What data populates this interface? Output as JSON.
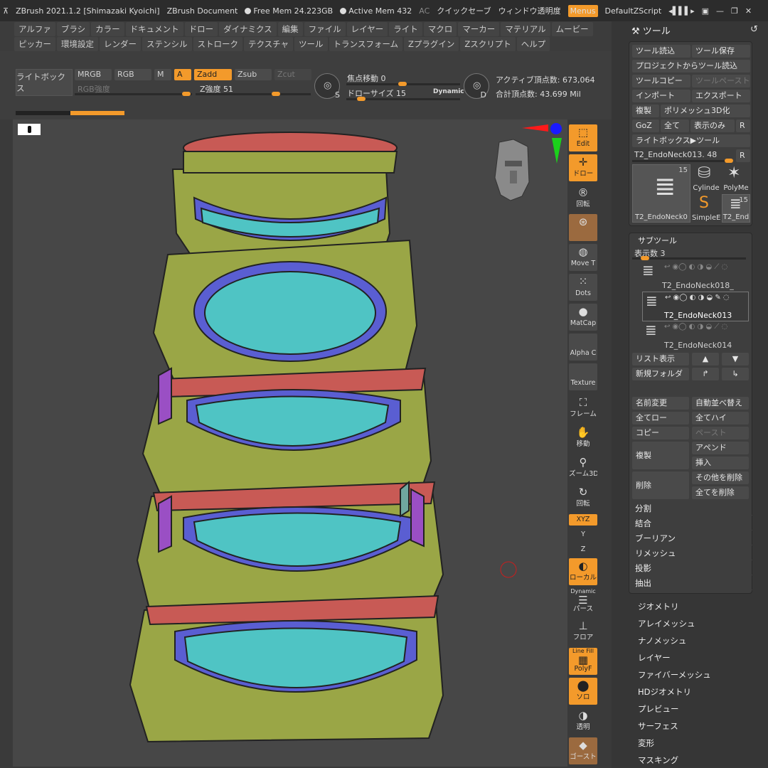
{
  "titlebar": {
    "app": "ZBrush 2021.1.2 [Shimazaki Kyoichi]",
    "doc": "ZBrush Document",
    "freemem": "Free Mem 24.223GB",
    "activemem": "Active Mem 432",
    "ac": "AC",
    "quicksave": "クイックセーブ",
    "transparency": "ウィンドウ透明度",
    "menus": "Menus",
    "script": "DefaultZScript"
  },
  "menubar": {
    "row1": [
      "アルファ",
      "ブラシ",
      "カラー",
      "ドキュメント",
      "ドロー",
      "ダイナミクス",
      "編集",
      "ファイル",
      "レイヤー",
      "ライト",
      "マクロ",
      "マーカー",
      "マテリアル",
      "ムービー"
    ],
    "row2": [
      "ピッカー",
      "環境設定",
      "レンダー",
      "ステンシル",
      "ストローク",
      "テクスチャ",
      "ツール",
      "トランスフォーム",
      "Zプラグイン",
      "Zスクリプト",
      "ヘルプ"
    ]
  },
  "shelf": {
    "lightbox": "ライトボックス",
    "mrgb": "MRGB",
    "rgb": "RGB",
    "m": "M",
    "a": "A",
    "zadd": "Zadd",
    "zsub": "Zsub",
    "zcut": "Zcut",
    "rgb_intensity": "RGB強度",
    "z_intensity": "Z強度",
    "z_intensity_val": "51",
    "focal": "焦点移動",
    "focal_val": "0",
    "drawsize": "ドローサイズ",
    "drawsize_val": "15",
    "dynamic": "Dynamic",
    "s": "S",
    "d": "D",
    "active_pts": "アクティブ頂点数: 673,064",
    "total_pts": "合計頂点数: 43.699 Mil"
  },
  "rightshelf": {
    "edit": "Edit",
    "draw": "ドロー",
    "rot": "回転",
    "move": "Move T",
    "dots": "Dots",
    "matcap": "MatCap",
    "alpha": "Alpha C",
    "texture": "Texture",
    "frame": "フレーム",
    "pan": "移動",
    "zoom": "ズーム3D",
    "rotate": "回転",
    "xyz": "XYZ",
    "y": "Y",
    "z": "Z",
    "local": "ローカル",
    "dynamic": "Dynamic",
    "persp": "パース",
    "floor": "フロア",
    "polyf": "PolyF",
    "line_fill": "Line Fill",
    "solo": "ソロ",
    "transp": "透明",
    "ghost": "ゴースト"
  },
  "panel": {
    "title": "ツール",
    "load": "ツール読込",
    "save": "ツール保存",
    "proj_load": "プロジェクトからツール読込",
    "copy": "ツールコピー",
    "paste": "ツールペースト",
    "import": "インポート",
    "export": "エクスポート",
    "clone": "複製",
    "polymesh": "ポリメッシュ3D化",
    "goz": "GoZ",
    "all": "全て",
    "visible": "表示のみ",
    "r": "R",
    "lb_tool": "ライトボックス▶ツール",
    "tool_name": "T2_EndoNeck013.",
    "tool_val": "48",
    "thumb1": "T2_EndoNeck0",
    "thumb1_count": "15",
    "thumb2": "Cylinde",
    "thumb3": "PolyMe",
    "thumb4": "SimpleE",
    "thumb5": "T2_End",
    "thumb5_count": "15",
    "subtool": "サブツール",
    "display": "表示数",
    "display_val": "3",
    "items": [
      "T2_EndoNeck018_",
      "T2_EndoNeck013",
      "T2_EndoNeck014"
    ],
    "list": "リスト表示",
    "newfolder": "新規フォルダ",
    "rename": "名前変更",
    "autoorder": "自動並べ替え",
    "alllow": "全てロー",
    "allhigh": "全てハイ",
    "copy2": "コピー",
    "paste2": "ペースト",
    "dup": "複製",
    "append": "アペンド",
    "insert": "挿入",
    "del": "削除",
    "delother": "その他を削除",
    "delall": "全てを削除",
    "acc": [
      "分割",
      "結合",
      "ブーリアン",
      "リメッシュ",
      "投影",
      "抽出"
    ],
    "menus": [
      "ジオメトリ",
      "アレイメッシュ",
      "ナノメッシュ",
      "レイヤー",
      "ファイバーメッシュ",
      "HDジオメトリ",
      "プレビュー",
      "サーフェス",
      "変形",
      "マスキング"
    ]
  }
}
